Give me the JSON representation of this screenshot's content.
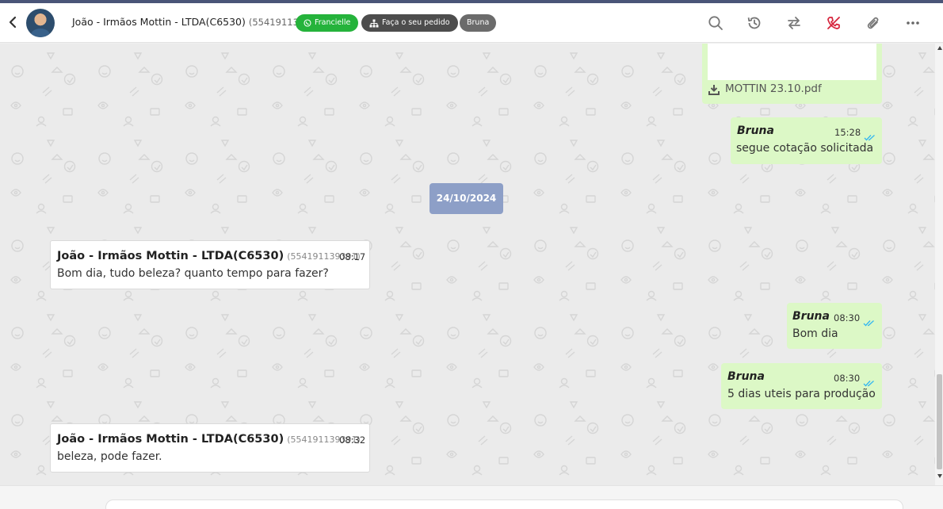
{
  "header": {
    "contact_name": "João - Irmãos Mottin - LTDA(C6530)",
    "contact_phone": "(554191139391)",
    "badges": [
      {
        "label": "Francielle",
        "color": "#25b33b"
      },
      {
        "label": "Faça o seu pedido",
        "color": "#4d4d4d"
      },
      {
        "label": "Bruna",
        "color": "#6b6b6b"
      }
    ],
    "icons": [
      "back-chevron-icon",
      "search-icon",
      "history-icon",
      "transfer-icon",
      "end-call-icon",
      "attach-icon",
      "more-icon"
    ]
  },
  "messages": {
    "attachment_name": "MOTTIN 23.10.pdf",
    "msg1": {
      "sender": "Bruna",
      "time": "15:28",
      "text": "segue cotação solicitada"
    },
    "date_separator": "24/10/2024",
    "msg2": {
      "sender": "João - Irmãos Mottin - LTDA(C6530)",
      "phone": "(554191139391)",
      "time": "08:17",
      "text": "Bom dia, tudo beleza? quanto tempo para fazer?"
    },
    "msg3": {
      "sender": "Bruna",
      "time": "08:30",
      "text": "Bom dia"
    },
    "msg4": {
      "sender": "Bruna",
      "time": "08:30",
      "text": "5 dias uteis para produção"
    },
    "msg5": {
      "sender": "João - Irmãos Mottin - LTDA(C6530)",
      "phone": "(554191139391)",
      "time": "08:32",
      "text": "beleza, pode fazer."
    }
  },
  "colors": {
    "outgoing": "#dcf8c6",
    "incoming": "#ffffff",
    "date_chip": "#8d9fc7",
    "read_ticks": "#34b7f1",
    "accent_red": "#d6243c"
  }
}
